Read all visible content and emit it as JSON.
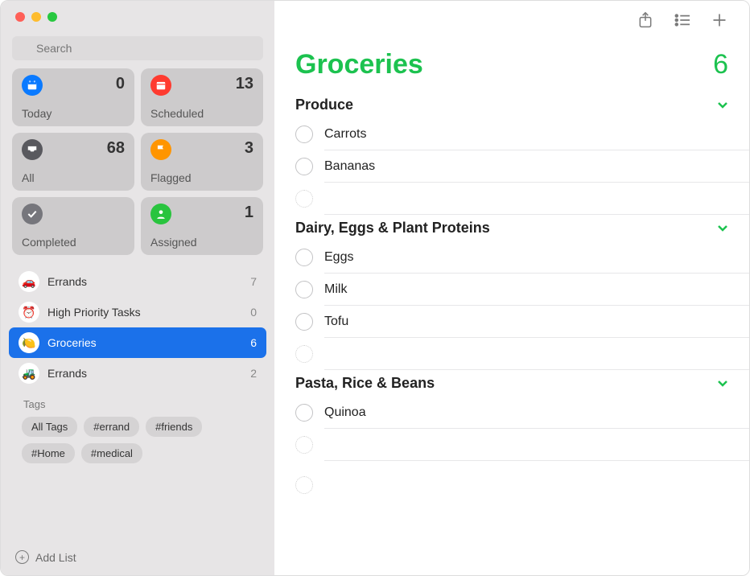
{
  "search": {
    "placeholder": "Search"
  },
  "smart": {
    "today": {
      "label": "Today",
      "count": 0
    },
    "scheduled": {
      "label": "Scheduled",
      "count": 13
    },
    "all": {
      "label": "All",
      "count": 68
    },
    "flagged": {
      "label": "Flagged",
      "count": 3
    },
    "completed": {
      "label": "Completed",
      "count": ""
    },
    "assigned": {
      "label": "Assigned",
      "count": 1
    }
  },
  "lists": [
    {
      "name": "Errands",
      "count": 7,
      "emoji": "🚗"
    },
    {
      "name": "High Priority Tasks",
      "count": 0,
      "emoji": "⏰"
    },
    {
      "name": "Groceries",
      "count": 6,
      "emoji": "🍋"
    },
    {
      "name": "Errands",
      "count": 2,
      "emoji": "🚜"
    }
  ],
  "tags": {
    "header": "Tags",
    "items": [
      "All Tags",
      "#errand",
      "#friends",
      "#Home",
      "#medical"
    ]
  },
  "footer": {
    "add_list": "Add List"
  },
  "main": {
    "title": "Groceries",
    "count": 6,
    "sections": [
      {
        "title": "Produce",
        "items": [
          "Carrots",
          "Bananas"
        ]
      },
      {
        "title": "Dairy, Eggs & Plant Proteins",
        "items": [
          "Eggs",
          "Milk",
          "Tofu"
        ]
      },
      {
        "title": "Pasta, Rice & Beans",
        "items": [
          "Quinoa"
        ]
      }
    ]
  }
}
